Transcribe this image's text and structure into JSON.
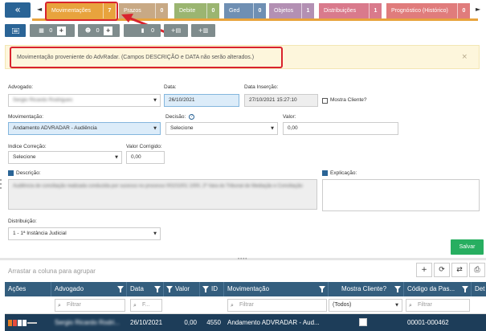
{
  "tabs": {
    "back_label": "«",
    "left_arrow": "◄",
    "right_arrow": "►",
    "items": [
      {
        "label": "Movimentações",
        "count": "7",
        "color": "#e8a33d"
      },
      {
        "label": "Prazos",
        "count": "0",
        "color": "#c8a985"
      },
      {
        "label": "Debite",
        "count": "0",
        "color": "#9bb571"
      },
      {
        "label": "Ged",
        "count": "0",
        "color": "#6f8fb3"
      },
      {
        "label": "Objetos",
        "count": "1",
        "color": "#b390b3"
      },
      {
        "label": "Distribuições",
        "count": "1",
        "color": "#d97a8c"
      },
      {
        "label": "Prognóstico (Histórico)",
        "count": "0",
        "color": "#e07c7c"
      }
    ]
  },
  "toolbar2": {
    "btn2_count": "0",
    "btn3_count": "0",
    "btn4_count": "0",
    "plus": "+"
  },
  "alert": {
    "text": "Movimentação proveniente do AdvRadar. (Campos DESCRIÇÃO e DATA não serão alterados.)",
    "close": "×"
  },
  "form": {
    "advogado_label": "Advogado:",
    "advogado_value": "Sergio Ricardo Rodrigues",
    "data_label": "Data:",
    "data_value": "26/10/2021",
    "data_insercao_label": "Data Inserção:",
    "data_insercao_value": "27/10/2021 15:27:10",
    "mostra_cliente_label": "Mostra Cliente?",
    "movimentacao_label": "Movimentação:",
    "movimentacao_value": "Andamento ADVRADAR - Audiência",
    "decisao_label": "Decisão:",
    "decisao_value": "Selecione",
    "valor_label": "Valor:",
    "valor_value": "0,00",
    "indice_label": "Indice Correção:",
    "indice_value": "Selecione",
    "valor_corrigido_label": "Valor Corrigido:",
    "valor_corrigido_value": "0,00",
    "descricao_label": "Descrição:",
    "descricao_value": "Audiência de conciliação realizada conduzida por sucesso no processo 00101001 1000, 2ª Vara do Tribunal de Mediação e Conciliação",
    "explicacao_label": "Explicação:",
    "distribuicao_label": "Distribuição:",
    "distribuicao_value": "1 - 1ª Instância Judicial",
    "save_label": "Salvar"
  },
  "grid": {
    "group_hint": "Arrastar a coluna para agrupar",
    "tools": [
      "+",
      "⟳",
      "⇄",
      "⎙"
    ],
    "columns": [
      "Ações",
      "Advogado",
      "Data",
      "Valor",
      "ID",
      "Movimentação",
      "Mostra Cliente?",
      "Código da Pas...",
      "Det"
    ],
    "filter_placeholder": "Filtrar",
    "filter_short": "F...",
    "filter_all": "(Todos)",
    "row": {
      "advogado": "Sergio Ricardo Rodri...",
      "data": "26/10/2021",
      "valor": "0,00",
      "id": "4550",
      "movimentacao": "Andamento ADVRADAR - Aud...",
      "codigo": "00001-000462"
    }
  }
}
